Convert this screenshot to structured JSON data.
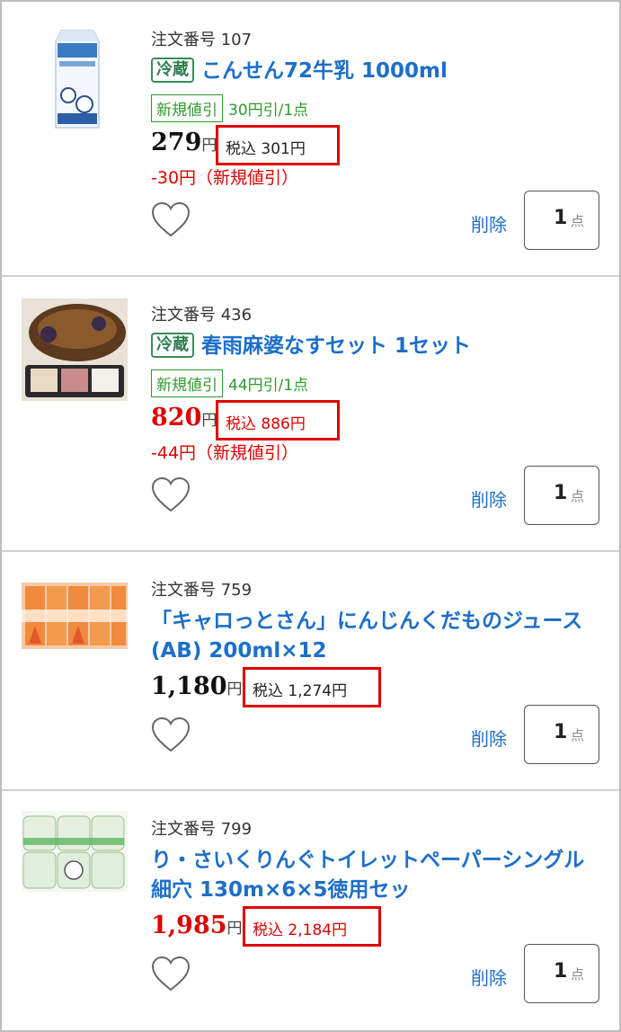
{
  "items": [
    {
      "order_label": "注文番号 107",
      "chill_label": "冷蔵",
      "title_line1": "こんせん72牛乳 1000ml",
      "title_line2": "",
      "discount_badge": "新規値引",
      "discount_amount": "30円引/1点",
      "price": "279",
      "yen": "円",
      "price_color": "black",
      "tax_text": "税込 301円",
      "discount_line": "-30円（新規値引）",
      "delete_label": "削除",
      "qty": "1",
      "qty_unit": "点",
      "thumb_icon": "milk-carton-image"
    },
    {
      "order_label": "注文番号 436",
      "chill_label": "冷蔵",
      "title_line1": "春雨麻婆なすセット 1セット",
      "title_line2": "",
      "discount_badge": "新規値引",
      "discount_amount": "44円引/1点",
      "price": "820",
      "yen": "円",
      "price_color": "red",
      "tax_text": "税込 886円",
      "discount_line": "-44円（新規値引）",
      "delete_label": "削除",
      "qty": "1",
      "qty_unit": "点",
      "thumb_icon": "mapo-eggplant-image"
    },
    {
      "order_label": "注文番号 759",
      "chill_label": "",
      "title_line1": "「キャロっとさん」にんじんくだものジュース",
      "title_line2": "(AB) 200ml×12",
      "discount_badge": "",
      "discount_amount": "",
      "price": "1,180",
      "yen": "円",
      "price_color": "black",
      "tax_text": "税込 1,274円",
      "discount_line": "",
      "delete_label": "削除",
      "qty": "1",
      "qty_unit": "点",
      "thumb_icon": "carrot-juice-pack-image"
    },
    {
      "order_label": "注文番号 799",
      "chill_label": "",
      "title_line1": "り・さいくりんぐトイレットペーパーシングル",
      "title_line2": "細穴 130m×6×5徳用セッ",
      "discount_badge": "",
      "discount_amount": "",
      "price": "1,985",
      "yen": "円",
      "price_color": "red",
      "tax_text": "税込 2,184円",
      "discount_line": "",
      "delete_label": "削除",
      "qty": "1",
      "qty_unit": "点",
      "thumb_icon": "toilet-paper-image"
    }
  ],
  "colors": {
    "link_blue": "#1d6fc8",
    "price_red": "#e00000",
    "discount_green": "#2e9a2e",
    "chill_green": "#2e7d4f"
  }
}
